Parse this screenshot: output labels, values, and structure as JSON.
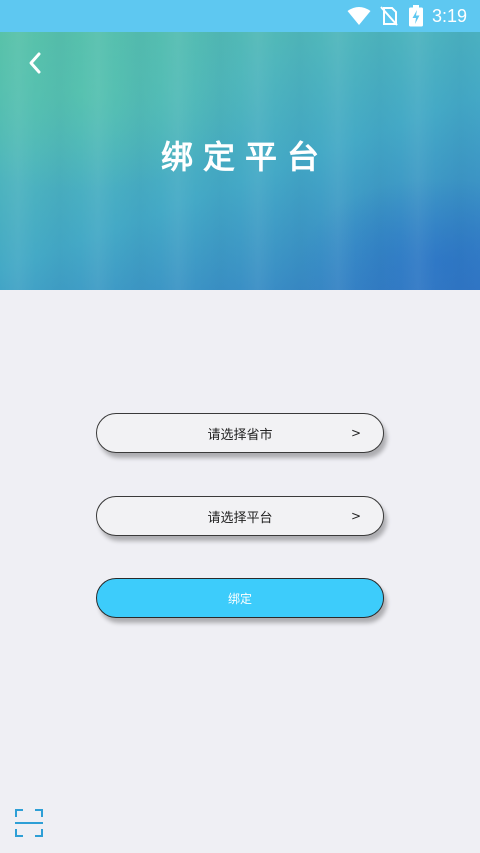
{
  "status_bar": {
    "time": "3:19",
    "icons": [
      "wifi-icon",
      "no-sim-icon",
      "battery-charging-icon"
    ]
  },
  "header": {
    "title": "绑定平台",
    "back_icon": "chevron-left-icon"
  },
  "form": {
    "province_select": {
      "label": "请选择省市",
      "arrow": ">"
    },
    "platform_select": {
      "label": "请选择平台",
      "arrow": ">"
    },
    "bind_button": {
      "label": "绑定"
    }
  },
  "footer": {
    "scan_icon": "scan-icon"
  },
  "colors": {
    "status_bar": "#5ec8f1",
    "header_start": "#58c1a8",
    "header_end": "#3478c2",
    "background": "#efeff4",
    "bind_button": "#3dccfb"
  }
}
